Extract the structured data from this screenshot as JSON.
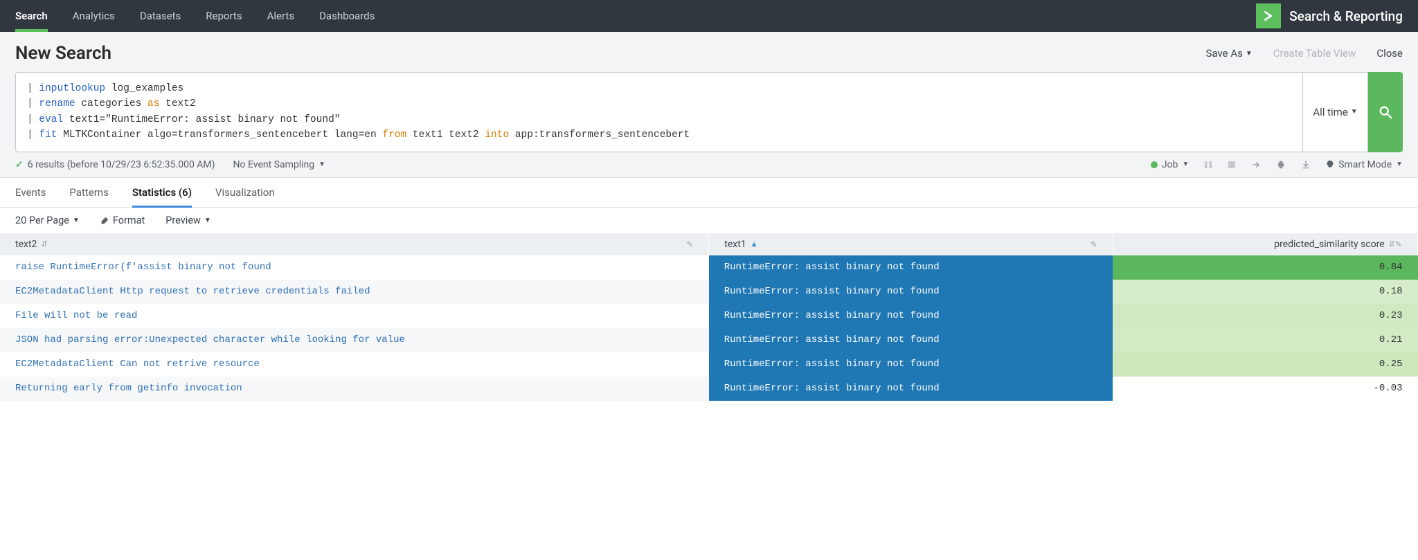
{
  "nav": {
    "items": [
      "Search",
      "Analytics",
      "Datasets",
      "Reports",
      "Alerts",
      "Dashboards"
    ],
    "active_index": 0,
    "app_title": "Search & Reporting"
  },
  "header": {
    "title": "New Search",
    "save_as": "Save As",
    "create_table_view": "Create Table View",
    "close": "Close"
  },
  "search": {
    "query_tokens": [
      [
        [
          "pipe",
          "| "
        ],
        [
          "cmd-blue",
          "inputlookup"
        ],
        [
          "plain",
          " log_examples"
        ]
      ],
      [
        [
          "pipe",
          "| "
        ],
        [
          "cmd-blue",
          "rename"
        ],
        [
          "plain",
          " categories "
        ],
        [
          "cmd-orange",
          "as"
        ],
        [
          "plain",
          " text2"
        ]
      ],
      [
        [
          "pipe",
          "| "
        ],
        [
          "cmd-blue",
          "eval"
        ],
        [
          "plain",
          " text1=\"RuntimeError: assist binary not found\""
        ]
      ],
      [
        [
          "pipe",
          "| "
        ],
        [
          "cmd-blue",
          "fit"
        ],
        [
          "plain",
          " MLTKContainer algo=transformers_sentencebert lang=en "
        ],
        [
          "cmd-orange",
          "from"
        ],
        [
          "plain",
          " text1 text2 "
        ],
        [
          "cmd-orange",
          "into"
        ],
        [
          "plain",
          " app:transformers_sentencebert"
        ]
      ]
    ],
    "time_range": "All time"
  },
  "status": {
    "results_text": "6 results (before 10/29/23 6:52:35.000 AM)",
    "sampling": "No Event Sampling",
    "job": "Job",
    "mode": "Smart Mode"
  },
  "tabs": {
    "items": [
      "Events",
      "Patterns",
      "Statistics (6)",
      "Visualization"
    ],
    "active_index": 2
  },
  "table_toolbar": {
    "per_page": "20 Per Page",
    "format": "Format",
    "preview": "Preview"
  },
  "table": {
    "columns": [
      {
        "key": "text2",
        "label": "text2",
        "sort": "neutral"
      },
      {
        "key": "text1",
        "label": "text1",
        "sort": "asc"
      },
      {
        "key": "score",
        "label": "predicted_similarity score",
        "sort": "neutral"
      }
    ],
    "rows": [
      {
        "text2": "raise RuntimeError(f'assist binary not found",
        "text1": "RuntimeError: assist binary not found",
        "score": "0.84",
        "score_bg": "#5bb75b",
        "score_fill_pct": 100
      },
      {
        "text2": "EC2MetadataClient Http request to retrieve credentials failed",
        "text1": "RuntimeError: assist binary not found",
        "score": "0.18",
        "score_bg": "#d7ecca",
        "score_fill_pct": 100
      },
      {
        "text2": "File will not be read",
        "text1": "RuntimeError: assist binary not found",
        "score": "0.23",
        "score_bg": "#d1e9c1",
        "score_fill_pct": 100
      },
      {
        "text2": "JSON had parsing error:Unexpected character while looking for value",
        "text1": "RuntimeError: assist binary not found",
        "score": "0.21",
        "score_bg": "#d4eac5",
        "score_fill_pct": 100
      },
      {
        "text2": "EC2MetadataClient Can not retrive resource",
        "text1": "RuntimeError: assist binary not found",
        "score": "0.25",
        "score_bg": "#cee7bd",
        "score_fill_pct": 100
      },
      {
        "text2": "Returning early from getinfo invocation",
        "text1": "RuntimeError: assist binary not found",
        "score": "-0.03",
        "score_bg": "#ffffff",
        "score_fill_pct": 0
      }
    ]
  }
}
